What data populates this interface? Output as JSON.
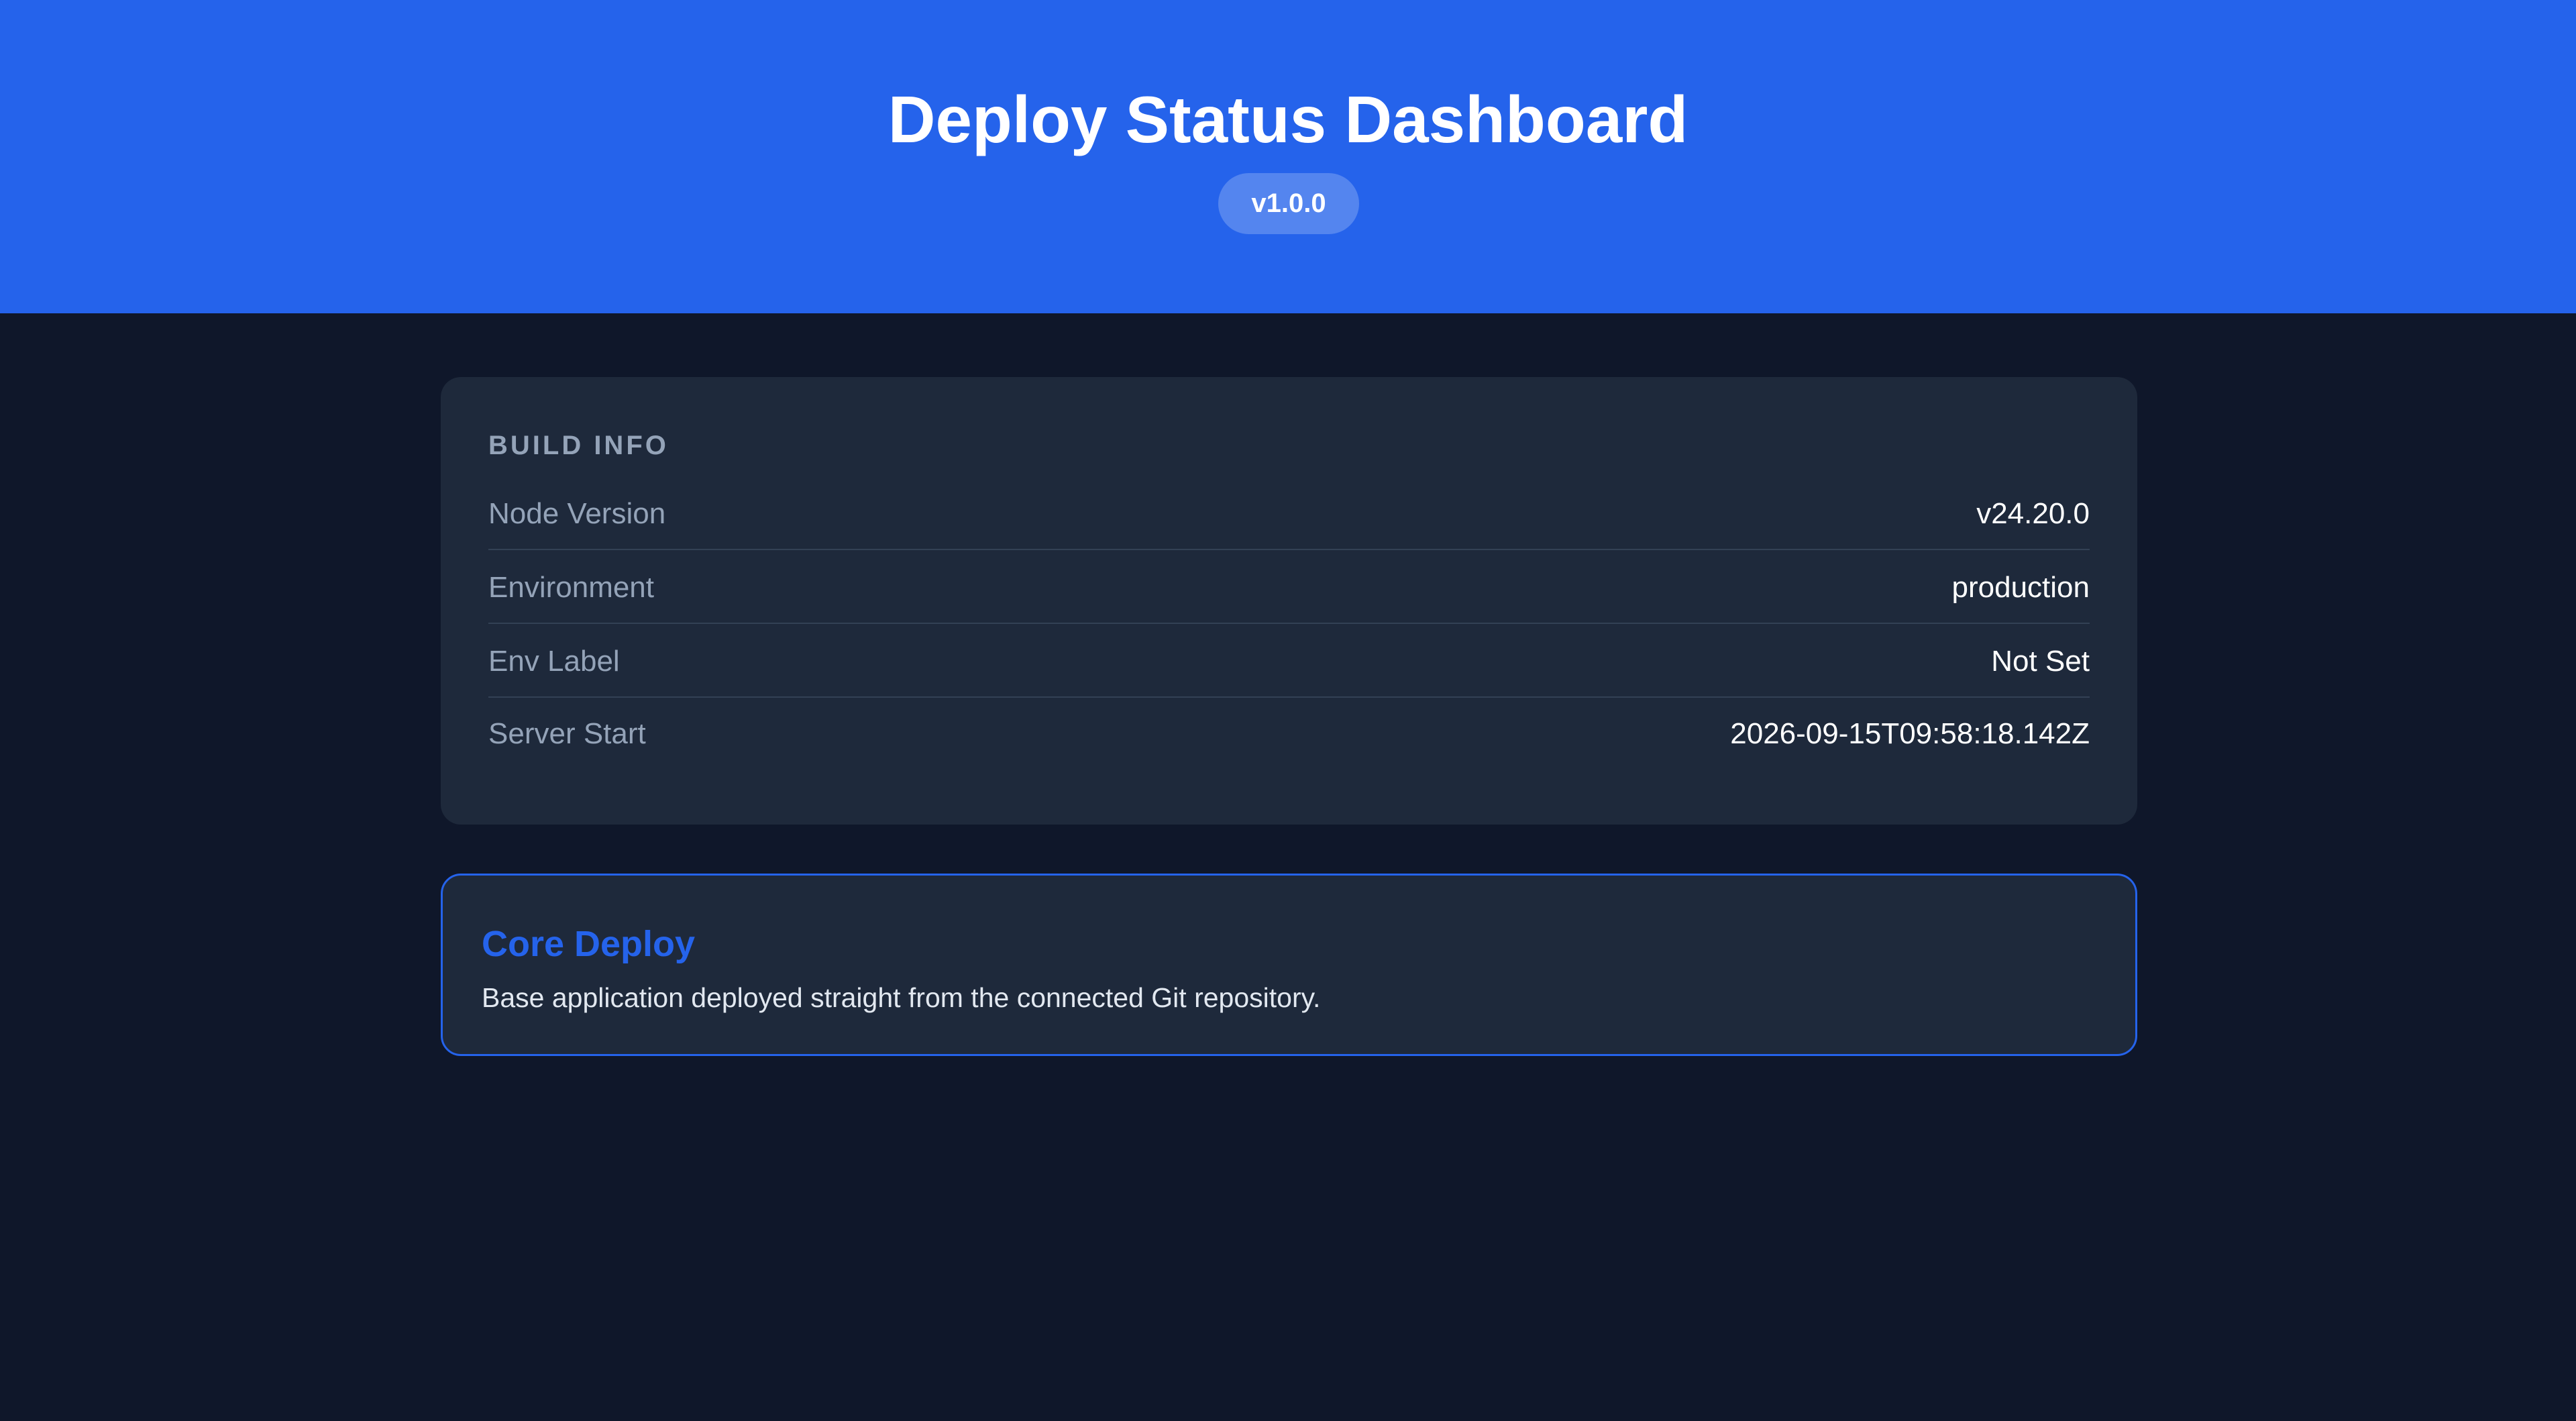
{
  "header": {
    "title": "Deploy Status Dashboard",
    "version": "v1.0.0"
  },
  "build_info": {
    "title": "BUILD INFO",
    "rows": [
      {
        "label": "Node Version",
        "value": "v24.20.0"
      },
      {
        "label": "Environment",
        "value": "production"
      },
      {
        "label": "Env Label",
        "value": "Not Set"
      },
      {
        "label": "Server Start",
        "value": "2026-09-15T09:58:18.142Z"
      }
    ]
  },
  "feature": {
    "title": "Core Deploy",
    "description": "Base application deployed straight from the connected Git repository."
  },
  "colors": {
    "header_bg": "#2563eb",
    "page_bg": "#0f172a",
    "card_bg": "#1e293b",
    "accent": "#2563eb"
  }
}
